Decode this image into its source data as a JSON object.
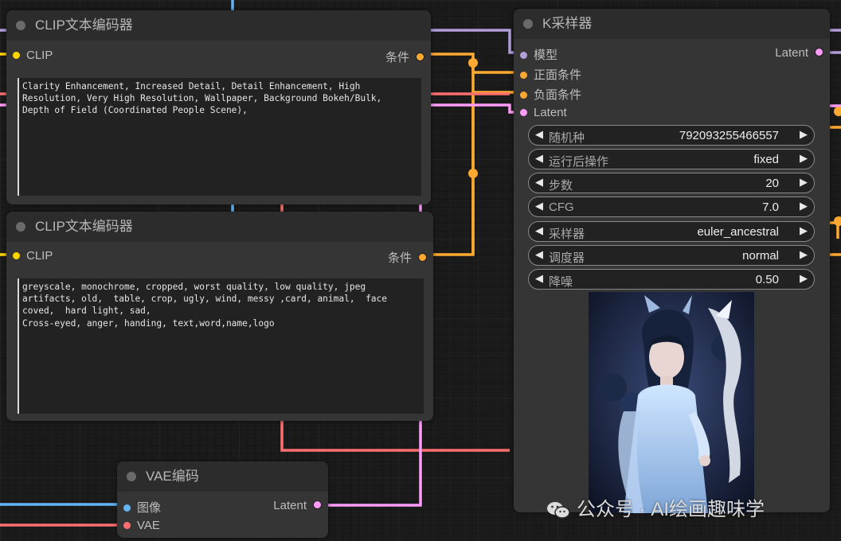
{
  "colors": {
    "clip": "#ffd500",
    "conditioning": "#ffa931",
    "model": "#b39ddb",
    "latent": "#ff9cf9",
    "image": "#64b5f6",
    "vae": "#ff6e6e"
  },
  "nodes": {
    "clip_positive": {
      "title": "CLIP文本编码器",
      "input_label": "CLIP",
      "output_label": "条件",
      "text": "Clarity Enhancement, Increased Detail, Detail Enhancement, High\nResolution, Very High Resolution, Wallpaper, Background Bokeh/Bulk,\nDepth of Field (Coordinated People Scene),"
    },
    "clip_negative": {
      "title": "CLIP文本编码器",
      "input_label": "CLIP",
      "output_label": "条件",
      "text": "greyscale, monochrome, cropped, worst quality, low quality, jpeg\nartifacts, old,  table, crop, ugly, wind, messy ,card, animal,  face\ncoved,  hard light, sad,\nCross-eyed, anger, handing, text,word,name,logo"
    },
    "vae_encode": {
      "title": "VAE编码",
      "inputs": [
        "图像",
        "VAE"
      ],
      "output_label": "Latent"
    },
    "ksampler": {
      "title": "K采样器",
      "inputs": [
        "模型",
        "正面条件",
        "负面条件",
        "Latent"
      ],
      "output_label": "Latent",
      "widgets": [
        {
          "label": "随机种",
          "value": "792093255466557"
        },
        {
          "label": "运行后操作",
          "value": "fixed"
        },
        {
          "label": "步数",
          "value": "20"
        },
        {
          "label": "CFG",
          "value": "7.0"
        },
        {
          "label": "采样器",
          "value": "euler_ancestral"
        },
        {
          "label": "调度器",
          "value": "normal"
        },
        {
          "label": "降噪",
          "value": "0.50"
        }
      ]
    }
  },
  "watermark": "公众号 · AI绘画趣味学"
}
